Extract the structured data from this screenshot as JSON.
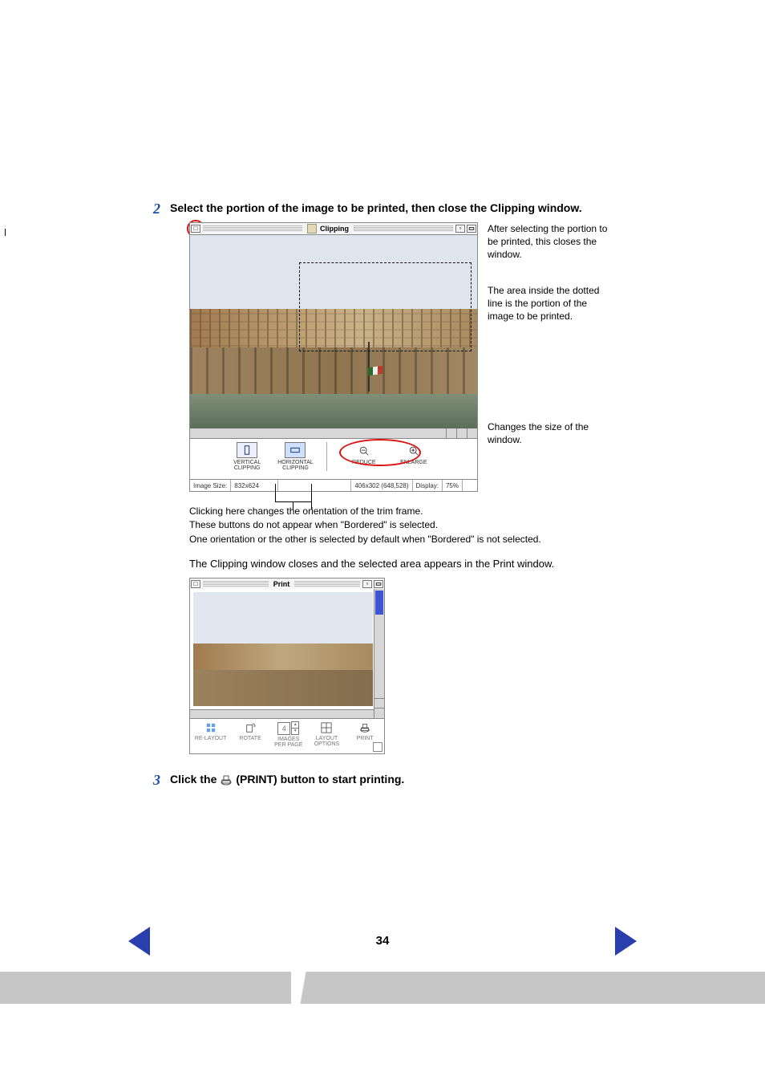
{
  "steps": {
    "s2": {
      "num": "2",
      "text": "Select the portion of the image to be printed, then close the Clipping window."
    },
    "s3": {
      "num": "3",
      "prefix": "Click the ",
      "suffix": " (PRINT) button to start printing."
    }
  },
  "clipping_window": {
    "title": "Clipping",
    "toolbar": {
      "vertical": "VERTICAL\nCLIPPING",
      "horizontal": "HORIZONTAL\nCLIPPING",
      "reduce": "REDUCE",
      "enlarge": "ENLARGE"
    },
    "status": {
      "label": "Image Size:",
      "size": "832x624",
      "crop": "406x302 (648,528)",
      "display_label": "Display:",
      "display_value": "75%"
    }
  },
  "callouts": {
    "close": "After selecting the portion to be printed, this closes the window.",
    "area": "The area inside the dotted line is the portion of the image to be printed.",
    "zoom": "Changes the size of the window."
  },
  "below_caption": {
    "l1": "Clicking here changes the orientation of the trim frame.",
    "l2": "These buttons do not appear when \"Bordered\" is selected.",
    "l3": "One orientation or the other is selected by default when \"Bordered\" is not selected."
  },
  "paragraph": "The Clipping window closes and the selected area appears in the Print window.",
  "print_window": {
    "title": "Print",
    "toolbar": {
      "relayout": "RE-LAYOUT",
      "rotate": "ROTATE",
      "images_per_page": "IMAGES\nPER PAGE",
      "images_per_page_value": "4",
      "layout_options": "LAYOUT\nOPTIONS",
      "print": "PRINT"
    }
  },
  "page_number": "34"
}
